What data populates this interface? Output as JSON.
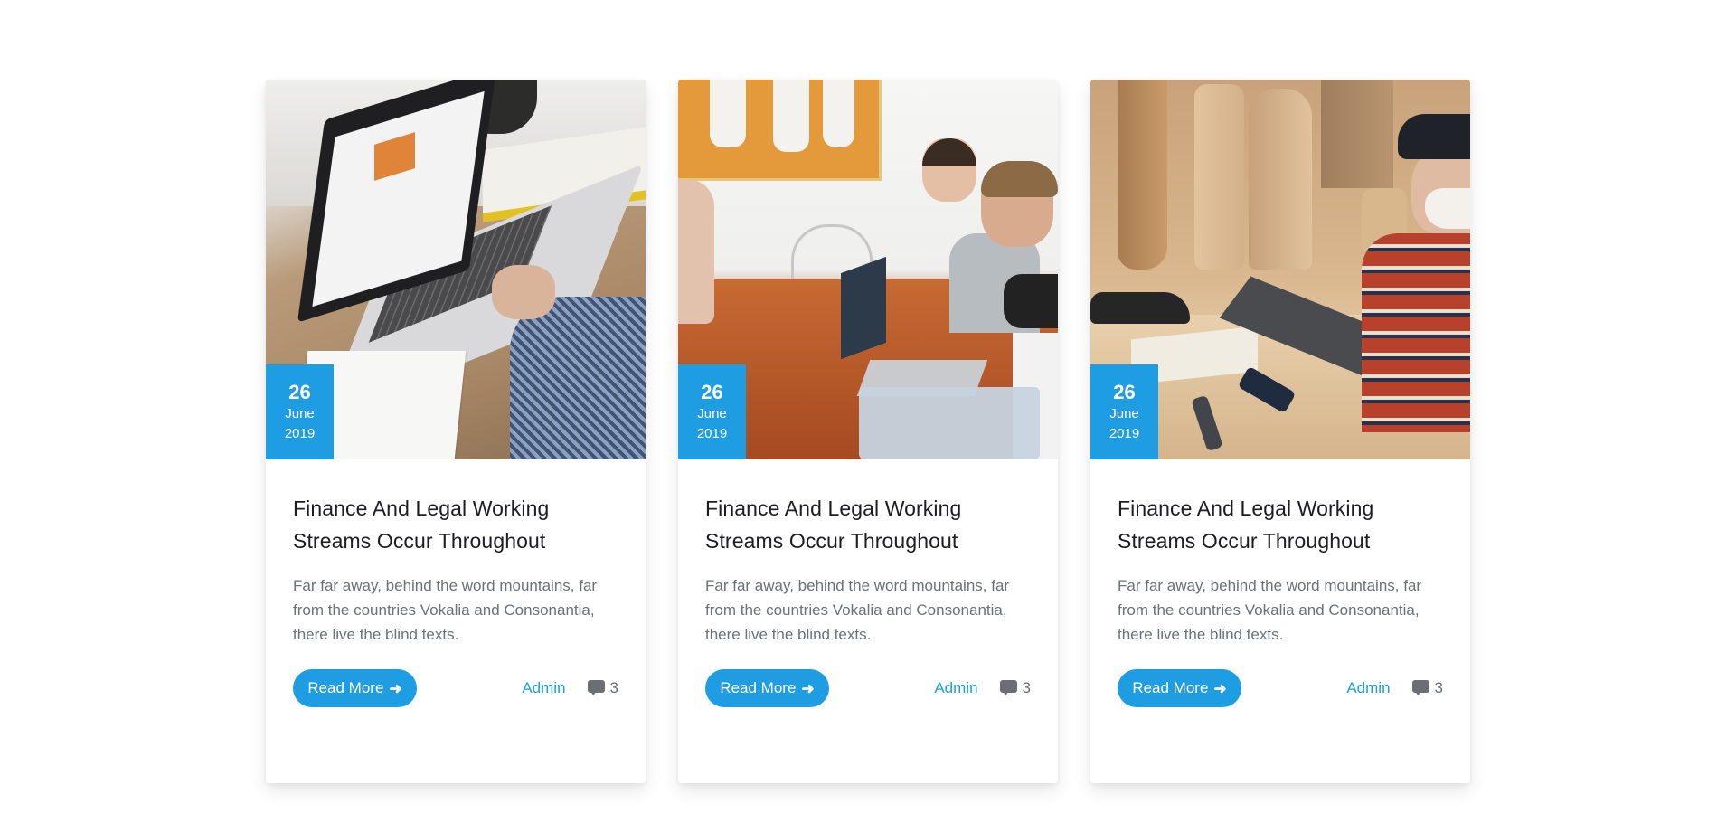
{
  "posts": [
    {
      "image": "laptop-on-wooden-desk",
      "date": {
        "day": "26",
        "month": "June",
        "year": "2019"
      },
      "title": "Finance And Legal Working Streams Occur Throughout",
      "excerpt": "Far far away, behind the word mountains, far from the countries Vokalia and Consonantia, there live the blind texts.",
      "read_more": "Read More",
      "read_more_icon": "arrow-right-icon",
      "author": "Admin",
      "comment_icon": "comment-icon",
      "comments": "3"
    },
    {
      "image": "team-meeting-with-laptops",
      "date": {
        "day": "26",
        "month": "June",
        "year": "2019"
      },
      "title": "Finance And Legal Working Streams Occur Throughout",
      "excerpt": "Far far away, behind the word mountains, far from the countries Vokalia and Consonantia, there live the blind texts.",
      "read_more": "Read More",
      "read_more_icon": "arrow-right-icon",
      "author": "Admin",
      "comment_icon": "comment-icon",
      "comments": "3"
    },
    {
      "image": "woodworker-with-laptop",
      "date": {
        "day": "26",
        "month": "June",
        "year": "2019"
      },
      "title": "Finance And Legal Working Streams Occur Throughout",
      "excerpt": "Far far away, behind the word mountains, far from the countries Vokalia and Consonantia, there live the blind texts.",
      "read_more": "Read More",
      "read_more_icon": "arrow-right-icon",
      "author": "Admin",
      "comment_icon": "comment-icon",
      "comments": "3"
    }
  ],
  "colors": {
    "accent": "#1e9de2",
    "title": "#1c1c24",
    "body_text": "#6c7178",
    "meta_icon": "#6b6f75",
    "background": "#ffffff"
  }
}
